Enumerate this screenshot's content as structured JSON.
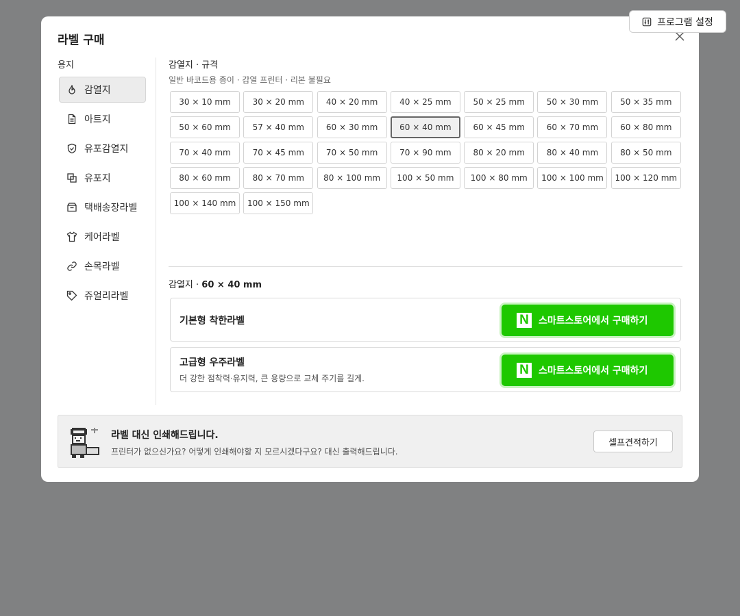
{
  "program_settings": {
    "label": "프로그램 설정",
    "icon": "settings-sliders-icon"
  },
  "modal": {
    "title": "라벨 구매",
    "close_icon": "close-icon"
  },
  "sidebar": {
    "heading": "용지",
    "items": [
      {
        "label": "감열지",
        "icon": "flame-icon",
        "active": true
      },
      {
        "label": "아트지",
        "icon": "document-icon",
        "active": false
      },
      {
        "label": "유포감열지",
        "icon": "shield-icon",
        "active": false
      },
      {
        "label": "유포지",
        "icon": "layers-icon",
        "active": false
      },
      {
        "label": "택배송장라벨",
        "icon": "box-icon",
        "active": false
      },
      {
        "label": "케어라벨",
        "icon": "shirt-icon",
        "active": false
      },
      {
        "label": "손목라벨",
        "icon": "link-icon",
        "active": false
      },
      {
        "label": "쥬얼리라벨",
        "icon": "tag-icon",
        "active": false
      }
    ]
  },
  "specs": {
    "title": "감열지 · 규격",
    "subtitle": "일반 바코드용 종이 · 감열 프린터 · 리본 불필요",
    "sizes": [
      "30 × 10 mm",
      "30 × 20 mm",
      "40 × 20 mm",
      "40 × 25 mm",
      "50 × 25 mm",
      "50 × 30 mm",
      "50 × 35 mm",
      "50 × 60 mm",
      "57 × 40 mm",
      "60 × 30 mm",
      "60 × 40 mm",
      "60 × 45 mm",
      "60 × 70 mm",
      "60 × 80 mm",
      "70 × 40 mm",
      "70 × 45 mm",
      "70 × 50 mm",
      "70 × 90 mm",
      "80 × 20 mm",
      "80 × 40 mm",
      "80 × 50 mm",
      "80 × 60 mm",
      "80 × 70 mm",
      "80 × 100 mm",
      "100 × 50 mm",
      "100 × 80 mm",
      "100 × 100 mm",
      "100 × 120 mm",
      "100 × 140 mm",
      "100 × 150 mm"
    ],
    "selected": "60 × 40 mm"
  },
  "selection": {
    "prefix": "감열지 · ",
    "size": "60 × 40 mm"
  },
  "products": [
    {
      "name": "기본형 착한라벨",
      "description": "",
      "buy_label": "스마트스토어에서 구매하기"
    },
    {
      "name": "고급형 우주라벨",
      "description": "더 강한 점착력·유지력, 큰 용량으로 교체 주기를 길게.",
      "buy_label": "스마트스토어에서 구매하기"
    }
  ],
  "naver_logo_letter": "N",
  "print_service": {
    "title": "라벨 대신 인쇄해드립니다.",
    "description": "프린터가 없으신가요? 어떻게 인쇄해야할 지 모르시겠다구요? 대신 출력해드립니다.",
    "button": "셀프견적하기"
  },
  "colors": {
    "accent_green": "#1ec800",
    "backdrop": "#808182"
  }
}
